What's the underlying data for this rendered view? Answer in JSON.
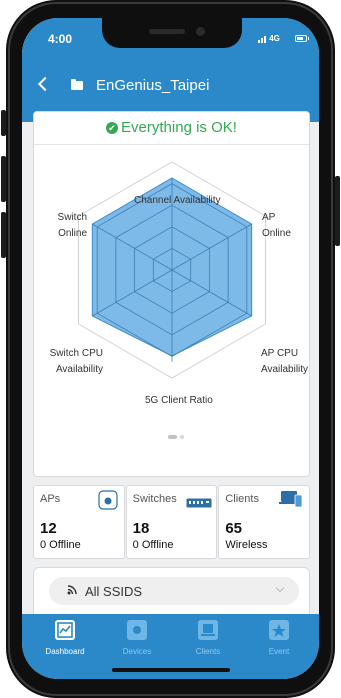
{
  "status_bar": {
    "time": "4:00",
    "network": "4G",
    "battery_level": 0.8
  },
  "header": {
    "site_name": "EnGenius_Taipei"
  },
  "health": {
    "message": "Everything is OK!",
    "color": "#34a853"
  },
  "radar": {
    "labels": {
      "top": "Channel Availability",
      "upper_left_1": "Switch",
      "upper_left_2": "Online",
      "upper_right_1": "AP",
      "upper_right_2": "Online",
      "lower_left_1": "Switch CPU",
      "lower_left_2": "Availability",
      "lower_right_1": "AP CPU",
      "lower_right_2": "Availability",
      "bottom": "5G Client Ratio"
    },
    "fill_color": "#6fb3e4",
    "page": 1,
    "pages": 2
  },
  "stats": {
    "aps": {
      "label": "APs",
      "count": "12",
      "sub": "0 Offline"
    },
    "switches": {
      "label": "Switches",
      "count": "18",
      "sub": "0 Offline"
    },
    "clients": {
      "label": "Clients",
      "count": "65",
      "sub": "Wireless"
    }
  },
  "ssid_filter": {
    "value": "All SSIDS"
  },
  "tabs": [
    {
      "label": "Dashboard",
      "icon": "dashboard-icon",
      "active": true
    },
    {
      "label": "Devices",
      "icon": "devices-icon",
      "active": false
    },
    {
      "label": "Clients",
      "icon": "clients-icon",
      "active": false
    },
    {
      "label": "Event",
      "icon": "event-icon",
      "active": false
    }
  ],
  "colors": {
    "primary": "#2c89c9",
    "background": "#eeeff1"
  }
}
